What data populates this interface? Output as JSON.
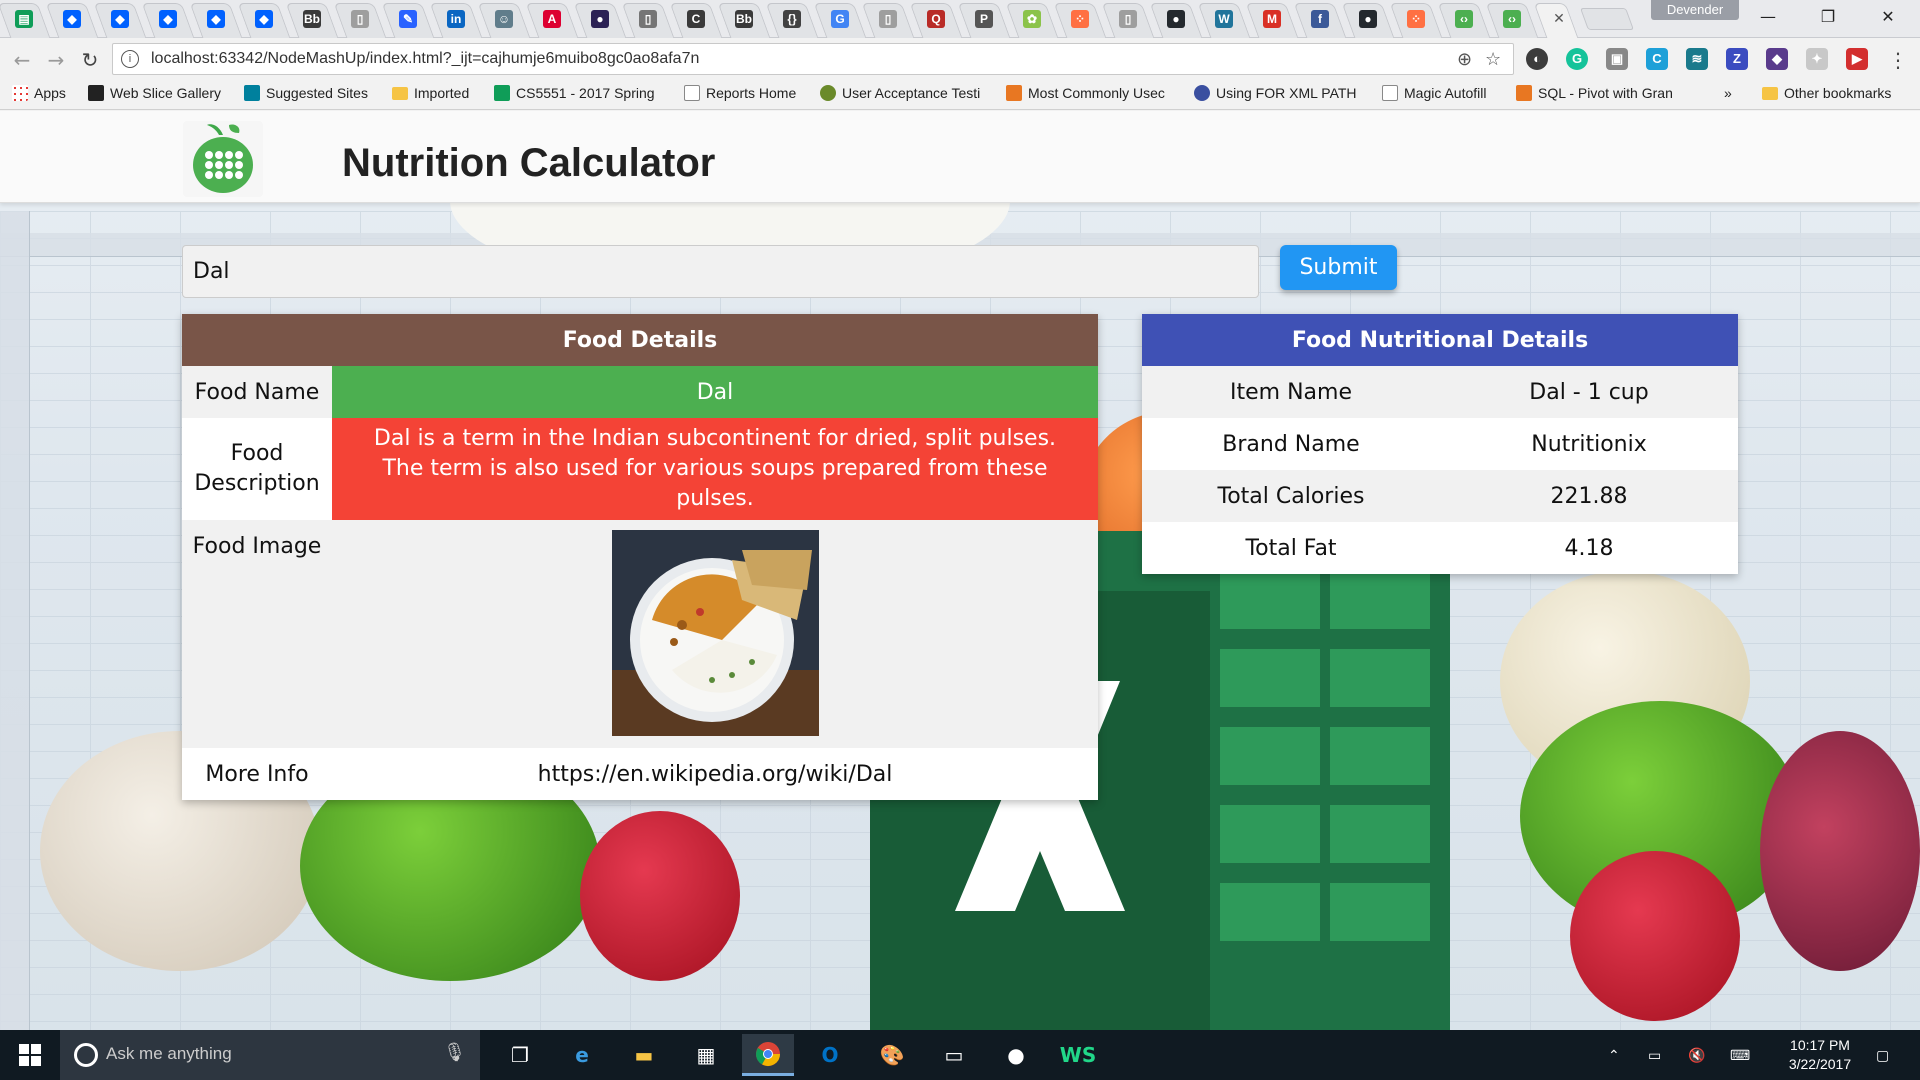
{
  "browser": {
    "profile_name": "Devender",
    "url": "localhost:63342/NodeMashUp/index.html?_ijt=cajhumje6muibo8gc0ao8afa7n",
    "tabs": [
      {
        "icon": "sheets-icon",
        "color": "#0f9d58",
        "glyph": "▤"
      },
      {
        "icon": "dropbox-icon",
        "color": "#0061fe",
        "glyph": "◆"
      },
      {
        "icon": "dropbox-icon",
        "color": "#0061fe",
        "glyph": "◆"
      },
      {
        "icon": "dropbox-icon",
        "color": "#0061fe",
        "glyph": "◆"
      },
      {
        "icon": "dropbox-icon",
        "color": "#0061fe",
        "glyph": "◆"
      },
      {
        "icon": "dropbox-icon",
        "color": "#0061fe",
        "glyph": "◆"
      },
      {
        "icon": "blackboard-icon",
        "color": "#3a3a3a",
        "glyph": "Bb"
      },
      {
        "icon": "page-icon",
        "color": "#9e9e9e",
        "glyph": "▯"
      },
      {
        "icon": "edit-icon",
        "color": "#2962ff",
        "glyph": "✎"
      },
      {
        "icon": "linkedin-icon",
        "color": "#0a66c2",
        "glyph": "in"
      },
      {
        "icon": "robot-icon",
        "color": "#607d8b",
        "glyph": "☺"
      },
      {
        "icon": "angular-icon",
        "color": "#dd0031",
        "glyph": "A"
      },
      {
        "icon": "eclipse-icon",
        "color": "#2c2255",
        "glyph": "●"
      },
      {
        "icon": "page-icon",
        "color": "#757575",
        "glyph": "▯"
      },
      {
        "icon": "cal-icon",
        "color": "#3a3a3a",
        "glyph": "C"
      },
      {
        "icon": "blackboard-icon",
        "color": "#3a3a3a",
        "glyph": "Bb"
      },
      {
        "icon": "json-icon",
        "color": "#424242",
        "glyph": "{}"
      },
      {
        "icon": "google-icon",
        "color": "#4285f4",
        "glyph": "G"
      },
      {
        "icon": "page-icon",
        "color": "#9e9e9e",
        "glyph": "▯"
      },
      {
        "icon": "quora-icon",
        "color": "#b92b27",
        "glyph": "Q"
      },
      {
        "icon": "p-icon",
        "color": "#555555",
        "glyph": "P"
      },
      {
        "icon": "leaf-icon",
        "color": "#8bc34a",
        "glyph": "✿"
      },
      {
        "icon": "dots-icon",
        "color": "#ff7043",
        "glyph": "⁘"
      },
      {
        "icon": "page-icon",
        "color": "#9e9e9e",
        "glyph": "▯"
      },
      {
        "icon": "github-icon",
        "color": "#24292e",
        "glyph": "●"
      },
      {
        "icon": "wordpress-icon",
        "color": "#21759b",
        "glyph": "W"
      },
      {
        "icon": "gmail-icon",
        "color": "#d93025",
        "glyph": "M"
      },
      {
        "icon": "facebook-icon",
        "color": "#3b5998",
        "glyph": "f"
      },
      {
        "icon": "github-icon",
        "color": "#24292e",
        "glyph": "●"
      },
      {
        "icon": "dots-icon",
        "color": "#ff7043",
        "glyph": "⁘"
      },
      {
        "icon": "chrome-dev-icon",
        "color": "#4caf50",
        "glyph": "‹›"
      },
      {
        "icon": "chrome-dev-icon",
        "color": "#4caf50",
        "glyph": "‹›"
      }
    ],
    "bookmarks": [
      {
        "label": "Apps",
        "icon": "apps-grid-icon"
      },
      {
        "label": "Web Slice Gallery",
        "icon": "web-slice-icon"
      },
      {
        "label": "Suggested Sites",
        "icon": "bing-icon"
      },
      {
        "label": "Imported",
        "icon": "folder-icon"
      },
      {
        "label": "CS5551 - 2017 Spring",
        "icon": "sheets-icon"
      },
      {
        "label": "Reports Home",
        "icon": "page-icon"
      },
      {
        "label": "User Acceptance Testi",
        "icon": "bug-icon"
      },
      {
        "label": "Most Commonly Usec",
        "icon": "stack-icon"
      },
      {
        "label": "Using FOR XML PATH",
        "icon": "globe-icon"
      },
      {
        "label": "Magic Autofill",
        "icon": "page-icon"
      },
      {
        "label": "SQL - Pivot with Gran",
        "icon": "stack-icon"
      }
    ],
    "bookmarks_overflow": "»",
    "other_bookmarks": "Other bookmarks"
  },
  "page": {
    "title": "Nutrition Calculator",
    "search": {
      "value": "Dal",
      "placeholder": ""
    },
    "submit_label": "Submit",
    "food_details": {
      "heading": "Food Details",
      "name_label": "Food Name",
      "name_value": "Dal",
      "desc_label": "Food Description",
      "desc_value": "Dal is a term in the Indian subcontinent for dried, split pulses. The term is also used for various soups prepared from these pulses.",
      "image_label": "Food Image",
      "more_label": "More Info",
      "more_value": "https://en.wikipedia.org/wiki/Dal"
    },
    "nutrition": {
      "heading": "Food Nutritional Details",
      "rows": [
        {
          "label": "Item Name",
          "value": "Dal - 1 cup"
        },
        {
          "label": "Brand Name",
          "value": "Nutritionix"
        },
        {
          "label": "Total Calories",
          "value": "221.88"
        },
        {
          "label": "Total Fat",
          "value": "4.18"
        }
      ]
    }
  },
  "taskbar": {
    "search_placeholder": "Ask me anything",
    "time": "10:17 PM",
    "date": "3/22/2017"
  }
}
